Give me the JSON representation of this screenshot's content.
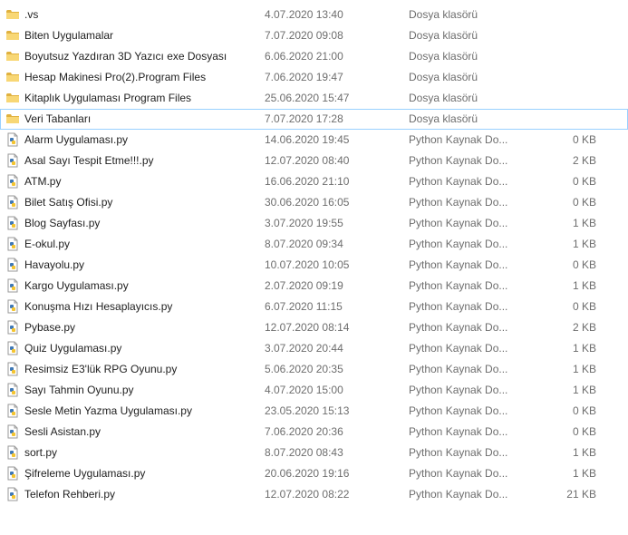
{
  "colors": {
    "folder": "#f8d775",
    "folder_dark": "#e0b13f",
    "focus_border": "#99d1ff",
    "meta_text": "#6d6d6d",
    "python_blue": "#3f78b5",
    "python_yellow": "#f4c430"
  },
  "files": [
    {
      "name": ".vs",
      "date": "4.07.2020 13:40",
      "type": "Dosya klasörü",
      "size": "",
      "icon": "folder-icon"
    },
    {
      "name": "Biten Uygulamalar",
      "date": "7.07.2020 09:08",
      "type": "Dosya klasörü",
      "size": "",
      "icon": "folder-icon"
    },
    {
      "name": "Boyutsuz Yazdıran 3D Yazıcı exe Dosyası",
      "date": "6.06.2020 21:00",
      "type": "Dosya klasörü",
      "size": "",
      "icon": "folder-icon"
    },
    {
      "name": "Hesap Makinesi Pro(2).Program Files",
      "date": "7.06.2020 19:47",
      "type": "Dosya klasörü",
      "size": "",
      "icon": "folder-icon"
    },
    {
      "name": "Kitaplık Uygulaması Program Files",
      "date": "25.06.2020 15:47",
      "type": "Dosya klasörü",
      "size": "",
      "icon": "folder-icon"
    },
    {
      "name": "Veri Tabanları",
      "date": "7.07.2020 17:28",
      "type": "Dosya klasörü",
      "size": "",
      "icon": "folder-icon"
    },
    {
      "name": "Alarm Uygulaması.py",
      "date": "14.06.2020 19:45",
      "type": "Python Kaynak Do...",
      "size": "0 KB",
      "icon": "python-file-icon"
    },
    {
      "name": "Asal Sayı Tespit Etme!!!.py",
      "date": "12.07.2020 08:40",
      "type": "Python Kaynak Do...",
      "size": "2 KB",
      "icon": "python-file-icon"
    },
    {
      "name": "ATM.py",
      "date": "16.06.2020 21:10",
      "type": "Python Kaynak Do...",
      "size": "0 KB",
      "icon": "python-file-icon"
    },
    {
      "name": "Bilet Satış Ofisi.py",
      "date": "30.06.2020 16:05",
      "type": "Python Kaynak Do...",
      "size": "0 KB",
      "icon": "python-file-icon"
    },
    {
      "name": "Blog Sayfası.py",
      "date": "3.07.2020 19:55",
      "type": "Python Kaynak Do...",
      "size": "1 KB",
      "icon": "python-file-icon"
    },
    {
      "name": "E-okul.py",
      "date": "8.07.2020 09:34",
      "type": "Python Kaynak Do...",
      "size": "1 KB",
      "icon": "python-file-icon"
    },
    {
      "name": "Havayolu.py",
      "date": "10.07.2020 10:05",
      "type": "Python Kaynak Do...",
      "size": "0 KB",
      "icon": "python-file-icon"
    },
    {
      "name": "Kargo Uygulaması.py",
      "date": "2.07.2020 09:19",
      "type": "Python Kaynak Do...",
      "size": "1 KB",
      "icon": "python-file-icon"
    },
    {
      "name": "Konuşma Hızı Hesaplayıcıs.py",
      "date": "6.07.2020 11:15",
      "type": "Python Kaynak Do...",
      "size": "0 KB",
      "icon": "python-file-icon"
    },
    {
      "name": "Pybase.py",
      "date": "12.07.2020 08:14",
      "type": "Python Kaynak Do...",
      "size": "2 KB",
      "icon": "python-file-icon"
    },
    {
      "name": "Quiz Uygulaması.py",
      "date": "3.07.2020 20:44",
      "type": "Python Kaynak Do...",
      "size": "1 KB",
      "icon": "python-file-icon"
    },
    {
      "name": "Resimsiz E3'lük RPG Oyunu.py",
      "date": "5.06.2020 20:35",
      "type": "Python Kaynak Do...",
      "size": "1 KB",
      "icon": "python-file-icon"
    },
    {
      "name": "Sayı Tahmin Oyunu.py",
      "date": "4.07.2020 15:00",
      "type": "Python Kaynak Do...",
      "size": "1 KB",
      "icon": "python-file-icon"
    },
    {
      "name": "Sesle Metin Yazma Uygulaması.py",
      "date": "23.05.2020 15:13",
      "type": "Python Kaynak Do...",
      "size": "0 KB",
      "icon": "python-file-icon"
    },
    {
      "name": "Sesli Asistan.py",
      "date": "7.06.2020 20:36",
      "type": "Python Kaynak Do...",
      "size": "0 KB",
      "icon": "python-file-icon"
    },
    {
      "name": "sort.py",
      "date": "8.07.2020 08:43",
      "type": "Python Kaynak Do...",
      "size": "1 KB",
      "icon": "python-file-icon"
    },
    {
      "name": "Şifreleme Uygulaması.py",
      "date": "20.06.2020 19:16",
      "type": "Python Kaynak Do...",
      "size": "1 KB",
      "icon": "python-file-icon"
    },
    {
      "name": "Telefon Rehberi.py",
      "date": "12.07.2020 08:22",
      "type": "Python Kaynak Do...",
      "size": "21 KB",
      "icon": "python-file-icon"
    }
  ],
  "focused_index": 5
}
